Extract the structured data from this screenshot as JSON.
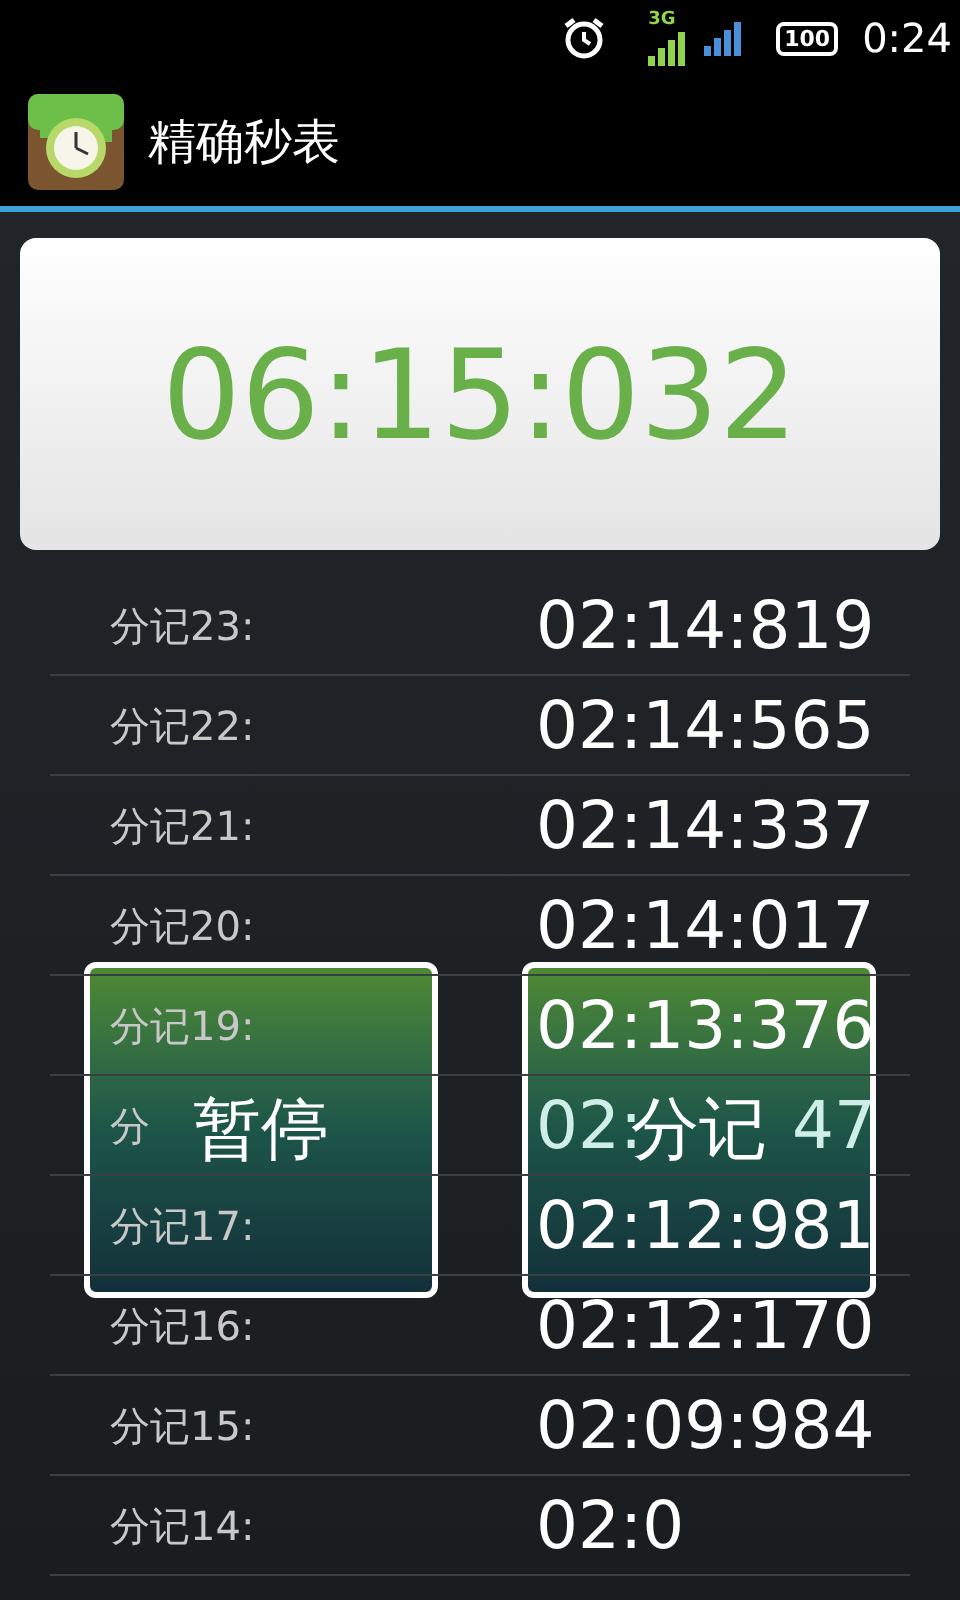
{
  "status_bar": {
    "network": "3G",
    "battery": "100",
    "time": "0:24"
  },
  "app_bar": {
    "title": "精确秒表"
  },
  "display": {
    "time": "06:15:032"
  },
  "laps": [
    {
      "label": "分记23:",
      "time": "02:14:819"
    },
    {
      "label": "分记22:",
      "time": "02:14:565"
    },
    {
      "label": "分记21:",
      "time": "02:14:337"
    },
    {
      "label": "分记20:",
      "time": "02:14:017"
    },
    {
      "label": "分记19:",
      "time": "02:13:376"
    },
    {
      "label": "分",
      "time": "02:",
      "time_tail": "47"
    },
    {
      "label": "分记17:",
      "time": "02:12:981"
    },
    {
      "label": "分记16:",
      "time": "02:12:170"
    },
    {
      "label": "分记15:",
      "time": "02:09:984"
    },
    {
      "label": "分记14:",
      "time": "02:0"
    }
  ],
  "buttons": [
    {
      "label": "暂停"
    },
    {
      "label": "分记"
    }
  ]
}
